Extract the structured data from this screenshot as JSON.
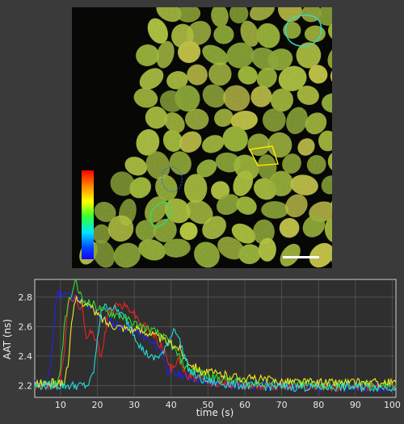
{
  "image": {
    "description_free": true,
    "colorbar": {
      "colors": [
        "#ff0000",
        "#ff8a00",
        "#ffff00",
        "#33ff33",
        "#00e5ff",
        "#0050ff",
        "#1a00ff"
      ]
    },
    "roi_colors": [
      "#36d8cc",
      "#ffe600",
      "#36d86a",
      "#2a56ff"
    ]
  },
  "chart_data": {
    "type": "line",
    "xlabel": "time (s)",
    "ylabel": "AAT (ns)",
    "xlim": [
      3,
      101
    ],
    "ylim": [
      2.12,
      2.92
    ],
    "xticks": [
      10,
      20,
      30,
      40,
      50,
      60,
      70,
      80,
      90,
      100
    ],
    "yticks": [
      2.2,
      2.4,
      2.6,
      2.8
    ],
    "grid": true,
    "series": [
      {
        "color": "#2222ee",
        "points": [
          [
            3,
            2.22
          ],
          [
            6,
            2.2
          ],
          [
            7,
            2.26
          ],
          [
            8,
            2.55
          ],
          [
            9,
            2.83
          ],
          [
            12,
            2.82
          ],
          [
            15,
            2.78
          ],
          [
            18,
            2.72
          ],
          [
            22,
            2.65
          ],
          [
            26,
            2.6
          ],
          [
            30,
            2.58
          ],
          [
            34,
            2.5
          ],
          [
            37,
            2.45
          ],
          [
            39,
            2.3
          ],
          [
            41,
            2.28
          ],
          [
            43,
            2.27
          ],
          [
            46,
            2.25
          ],
          [
            50,
            2.22
          ],
          [
            60,
            2.2
          ],
          [
            70,
            2.2
          ],
          [
            80,
            2.19
          ],
          [
            90,
            2.19
          ],
          [
            101,
            2.19
          ]
        ]
      },
      {
        "color": "#ee2222",
        "points": [
          [
            3,
            2.2
          ],
          [
            8,
            2.2
          ],
          [
            10,
            2.22
          ],
          [
            11,
            2.45
          ],
          [
            12,
            2.75
          ],
          [
            14,
            2.8
          ],
          [
            16,
            2.7
          ],
          [
            17,
            2.5
          ],
          [
            18,
            2.6
          ],
          [
            20,
            2.5
          ],
          [
            21,
            2.38
          ],
          [
            23,
            2.7
          ],
          [
            26,
            2.75
          ],
          [
            29,
            2.72
          ],
          [
            32,
            2.62
          ],
          [
            35,
            2.55
          ],
          [
            38,
            2.45
          ],
          [
            40,
            2.3
          ],
          [
            42,
            2.4
          ],
          [
            44,
            2.26
          ],
          [
            47,
            2.25
          ],
          [
            50,
            2.22
          ],
          [
            60,
            2.2
          ],
          [
            70,
            2.2
          ],
          [
            80,
            2.19
          ],
          [
            90,
            2.19
          ],
          [
            101,
            2.2
          ]
        ]
      },
      {
        "color": "#33dd33",
        "points": [
          [
            3,
            2.21
          ],
          [
            9,
            2.22
          ],
          [
            10,
            2.28
          ],
          [
            11,
            2.6
          ],
          [
            12,
            2.75
          ],
          [
            13,
            2.82
          ],
          [
            14,
            2.9
          ],
          [
            16,
            2.78
          ],
          [
            19,
            2.75
          ],
          [
            22,
            2.7
          ],
          [
            26,
            2.68
          ],
          [
            30,
            2.62
          ],
          [
            34,
            2.58
          ],
          [
            37,
            2.55
          ],
          [
            40,
            2.48
          ],
          [
            42,
            2.4
          ],
          [
            44,
            2.32
          ],
          [
            47,
            2.3
          ],
          [
            50,
            2.26
          ],
          [
            60,
            2.22
          ],
          [
            70,
            2.21
          ],
          [
            80,
            2.2
          ],
          [
            90,
            2.2
          ],
          [
            101,
            2.2
          ]
        ]
      },
      {
        "color": "#eeee22",
        "points": [
          [
            3,
            2.21
          ],
          [
            11,
            2.22
          ],
          [
            12,
            2.35
          ],
          [
            13,
            2.6
          ],
          [
            14,
            2.78
          ],
          [
            17,
            2.76
          ],
          [
            20,
            2.68
          ],
          [
            23,
            2.62
          ],
          [
            26,
            2.6
          ],
          [
            30,
            2.58
          ],
          [
            34,
            2.56
          ],
          [
            37,
            2.52
          ],
          [
            40,
            2.48
          ],
          [
            42,
            2.46
          ],
          [
            44,
            2.38
          ],
          [
            46,
            2.34
          ],
          [
            48,
            2.3
          ],
          [
            52,
            2.28
          ],
          [
            60,
            2.25
          ],
          [
            70,
            2.23
          ],
          [
            80,
            2.22
          ],
          [
            90,
            2.22
          ],
          [
            101,
            2.22
          ]
        ]
      },
      {
        "color": "#22dddd",
        "points": [
          [
            3,
            2.2
          ],
          [
            17,
            2.2
          ],
          [
            18,
            2.22
          ],
          [
            19,
            2.3
          ],
          [
            20,
            2.5
          ],
          [
            21,
            2.72
          ],
          [
            23,
            2.74
          ],
          [
            26,
            2.7
          ],
          [
            29,
            2.6
          ],
          [
            32,
            2.45
          ],
          [
            35,
            2.38
          ],
          [
            38,
            2.42
          ],
          [
            41,
            2.6
          ],
          [
            43,
            2.45
          ],
          [
            45,
            2.3
          ],
          [
            48,
            2.24
          ],
          [
            52,
            2.22
          ],
          [
            60,
            2.2
          ],
          [
            70,
            2.19
          ],
          [
            80,
            2.19
          ],
          [
            90,
            2.19
          ],
          [
            101,
            2.19
          ]
        ]
      }
    ]
  }
}
